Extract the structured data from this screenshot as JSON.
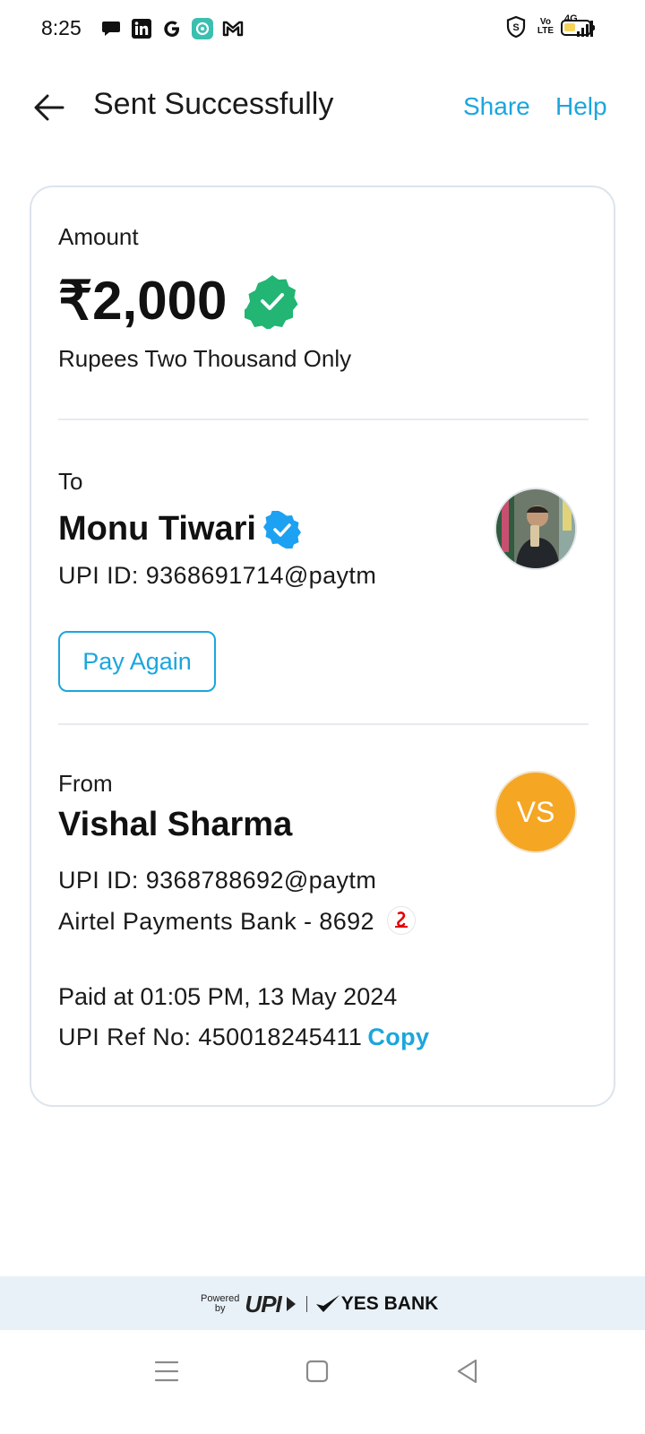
{
  "status_bar": {
    "time": "8:25",
    "left_icons": [
      "chat-bubble-icon",
      "linkedin-icon",
      "google-icon",
      "app-icon",
      "gmail-icon"
    ],
    "right_icons": [
      "shield-icon",
      "volte-icon",
      "signal-4g-icon",
      "battery-icon"
    ],
    "volte_text_top": "Vo",
    "volte_text_bottom": "LTE",
    "network": "4G"
  },
  "header": {
    "title": "Sent Successfully",
    "share": "Share",
    "help": "Help"
  },
  "amount_section": {
    "label": "Amount",
    "value": "₹2,000",
    "in_words": "Rupees Two Thousand Only"
  },
  "to_section": {
    "label": "To",
    "name": "Monu Tiwari",
    "upi_id": "UPI ID: 9368691714@paytm",
    "pay_again": "Pay Again"
  },
  "from_section": {
    "label": "From",
    "name": "Vishal Sharma",
    "initials": "VS",
    "upi_id": "UPI ID: 9368788692@paytm",
    "bank": "Airtel Payments Bank - 8692"
  },
  "details": {
    "paid_at": "Paid at 01:05 PM, 13 May 2024",
    "ref_label": "UPI Ref No: 450018245411",
    "copy": "Copy"
  },
  "footer": {
    "powered_line1": "Powered",
    "powered_line2": "by",
    "upi": "UPI",
    "bank": "YES BANK"
  },
  "colors": {
    "accent": "#1ba6dd",
    "success_green": "#22b573",
    "verified_blue": "#1da1f2",
    "avatar_orange": "#f5a623"
  }
}
